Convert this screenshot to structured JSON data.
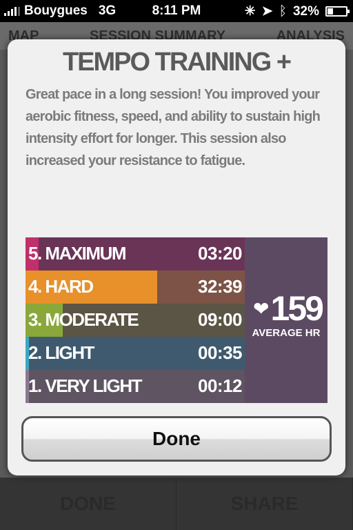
{
  "status_bar": {
    "carrier": "Bouygues",
    "network": "3G",
    "time": "8:11 PM",
    "battery_percent_label": "32%",
    "battery_level": 0.32
  },
  "background_tabs": [
    "MAP",
    "SESSION SUMMARY",
    "ANALYSIS"
  ],
  "background_bottom": {
    "done_label": "DONE",
    "share_label": "SHARE"
  },
  "modal": {
    "title": "TEMPO TRAINING +",
    "description": "Great pace in a long session! You improved your aerobic fitness, speed, and ability to sustain high intensity effort for longer. This session also increased your resistance to fatigue.",
    "zones": [
      {
        "label": "5. MAXIMUM",
        "duration": "03:20",
        "fraction": 0.06,
        "bar_color": "#c0306a",
        "bg_color": "#6a3457"
      },
      {
        "label": "4. HARD",
        "duration": "32:39",
        "fraction": 0.6,
        "bar_color": "#e8902a",
        "bg_color": "#7c5346"
      },
      {
        "label": "3. MODERATE",
        "duration": "09:00",
        "fraction": 0.17,
        "bar_color": "#8aa83a",
        "bg_color": "#5b5546"
      },
      {
        "label": "2. LIGHT",
        "duration": "00:35",
        "fraction": 0.01,
        "bar_color": "#3aa8c8",
        "bg_color": "#3f5a6e"
      },
      {
        "label": "1. VERY LIGHT",
        "duration": "00:12",
        "fraction": 0.01,
        "bar_color": "#8a7a8e",
        "bg_color": "#5e5462"
      }
    ],
    "average_hr": {
      "value": "159",
      "label": "AVERAGE HR",
      "icon": "heart-icon"
    },
    "done_label": "Done"
  }
}
